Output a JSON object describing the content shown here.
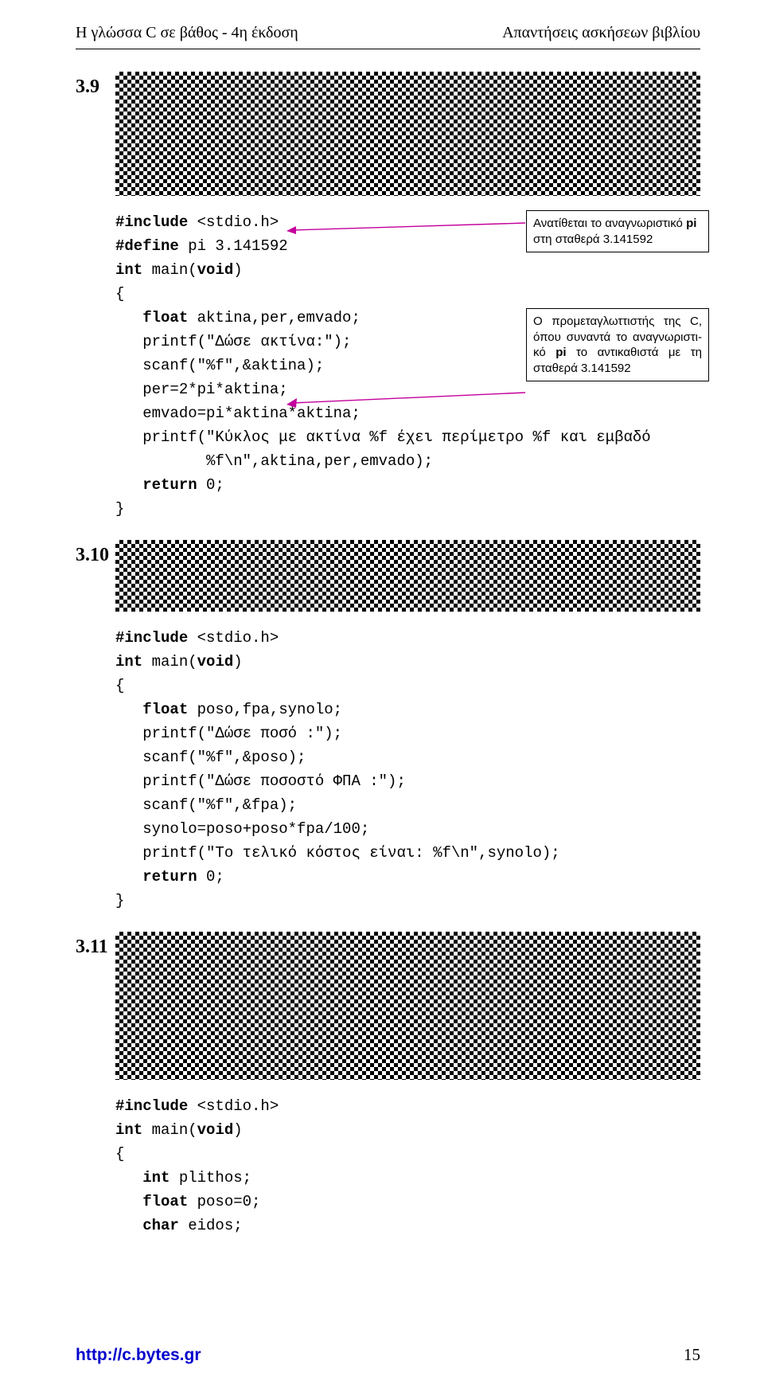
{
  "header": {
    "left": "Η γλώσσα C σε βάθος - 4η έκδοση",
    "right": "Απαντήσεις ασκήσεων βιβλίου"
  },
  "ex39": {
    "num": "3.9",
    "callout1_a": "Ανατίθεται το αναγνωριστικό ",
    "callout1_b": "pi",
    "callout1_c": " στη σταθερά 3.141592",
    "callout2_a": "Ο προμεταγλωττιστής της C, όπου συναντά το αναγνωριστι­κό ",
    "callout2_b": "pi",
    "callout2_c": " το αντικαθιστά με τη σταθερά 3.141592",
    "code_l1a": "#include",
    "code_l1b": " <stdio.h>",
    "code_l2a": "#define",
    "code_l2b": " pi 3.141592",
    "code_l3a": "int",
    "code_l3b": " main(",
    "code_l3c": "void",
    "code_l3d": ")",
    "code_l4": "{",
    "code_l5a": "   float",
    "code_l5b": " aktina,per,emvado;",
    "code_l6": "   printf(\"Δώσε ακτίνα:\");",
    "code_l7": "   scanf(\"%f\",&aktina);",
    "code_l8": "   per=2*pi*aktina;",
    "code_l9": "   emvado=pi*aktina*aktina;",
    "code_l10": "   printf(\"Κύκλος με ακτίνα %f έχει περίμετρο %f και εμβαδό",
    "code_l11": "          %f\\n\",aktina,per,emvado);",
    "code_l12a": "   return",
    "code_l12b": " 0;",
    "code_l13": "}"
  },
  "ex310": {
    "num": "3.10",
    "code_l1a": "#include",
    "code_l1b": " <stdio.h>",
    "code_l3a": "int",
    "code_l3b": " main(",
    "code_l3c": "void",
    "code_l3d": ")",
    "code_l4": "{",
    "code_l5a": "   float",
    "code_l5b": " poso,fpa,synolo;",
    "code_l6": "   printf(\"Δώσε ποσό :\");",
    "code_l7": "   scanf(\"%f\",&poso);",
    "code_l8": "   printf(\"Δώσε ποσοστό ΦΠΑ :\");",
    "code_l9": "   scanf(\"%f\",&fpa);",
    "code_l10": "   synolo=poso+poso*fpa/100;",
    "code_l11": "   printf(\"Το τελικό κόστος είναι: %f\\n\",synolo);",
    "code_l12a": "   return",
    "code_l12b": " 0;",
    "code_l13": "}"
  },
  "ex311": {
    "num": "3.11",
    "code_l1a": "#include",
    "code_l1b": " <stdio.h>",
    "code_l3a": "int",
    "code_l3b": " main(",
    "code_l3c": "void",
    "code_l3d": ")",
    "code_l4": "{",
    "code_l5a": "   int",
    "code_l5b": " plithos;",
    "code_l6a": "   float",
    "code_l6b": " poso=0;",
    "code_l7a": "   char",
    "code_l7b": " eidos;"
  },
  "footer": {
    "url": "http://c.bytes.gr",
    "page": "15"
  }
}
